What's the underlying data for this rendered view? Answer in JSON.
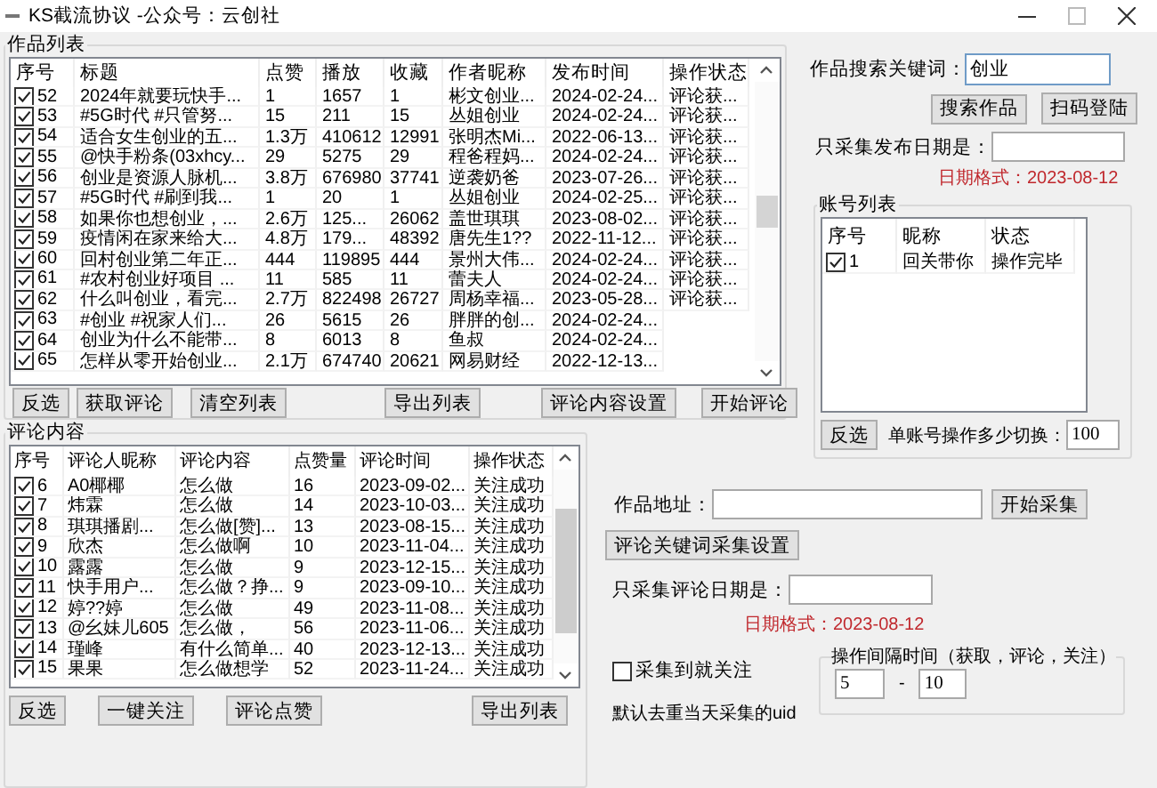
{
  "window": {
    "title": "KS截流协议 -公众号：云创社"
  },
  "works": {
    "title": "作品列表",
    "columns": [
      "序号",
      "标题",
      "点赞",
      "播放",
      "收藏",
      "作者昵称",
      "发布时间",
      "操作状态"
    ],
    "rows": [
      {
        "checked": true,
        "cells": [
          "52",
          "2024年就要玩快手...",
          "1",
          "1657",
          "1",
          "彬文创业...",
          "2024-02-24...",
          "评论获..."
        ]
      },
      {
        "checked": true,
        "cells": [
          "53",
          "#5G时代 #只管努...",
          "15",
          "211",
          "15",
          "丛姐创业",
          "2024-02-24...",
          "评论获..."
        ]
      },
      {
        "checked": true,
        "cells": [
          "54",
          "适合女生创业的五...",
          "1.3万",
          "410612",
          "12991",
          "张明杰Mi...",
          "2022-06-13...",
          "评论获..."
        ]
      },
      {
        "checked": true,
        "cells": [
          "55",
          "@快手粉条(03xhcy...",
          "29",
          "5275",
          "29",
          "程爸程妈...",
          "2024-02-24...",
          "评论获..."
        ]
      },
      {
        "checked": true,
        "cells": [
          "56",
          "创业是资源人脉机...",
          "3.8万",
          "676980",
          "37741",
          "逆袭奶爸",
          "2023-07-26...",
          "评论获..."
        ]
      },
      {
        "checked": true,
        "cells": [
          "57",
          "#5G时代 #刷到我...",
          "1",
          "20",
          "1",
          "丛姐创业",
          "2024-02-25...",
          "评论获..."
        ]
      },
      {
        "checked": true,
        "cells": [
          "58",
          "如果你也想创业，...",
          "2.6万",
          "125...",
          "26062",
          "盖世琪琪",
          "2023-08-02...",
          "评论获..."
        ]
      },
      {
        "checked": true,
        "cells": [
          "59",
          "疫情闲在家来给大...",
          "4.8万",
          "179...",
          "48392",
          "唐先生1??",
          "2022-11-12...",
          "评论获..."
        ]
      },
      {
        "checked": true,
        "cells": [
          "60",
          "回村创业第二年正...",
          "444",
          "119895",
          "444",
          "景州大伟...",
          "2024-02-24...",
          "评论获..."
        ]
      },
      {
        "checked": true,
        "cells": [
          "61",
          "#农村创业好项目 ...",
          "11",
          "585",
          "11",
          "蕾夫人",
          "2024-02-24...",
          "评论获..."
        ]
      },
      {
        "checked": true,
        "cells": [
          "62",
          "什么叫创业，看完...",
          "2.7万",
          "822498",
          "26727",
          "周杨幸福...",
          "2023-05-28...",
          "评论获..."
        ]
      },
      {
        "checked": true,
        "cells": [
          "63",
          "#创业 #祝家人们...",
          "26",
          "5615",
          "26",
          "胖胖的创...",
          "2024-02-24..."
        ]
      },
      {
        "checked": true,
        "cells": [
          "64",
          "创业为什么不能带...",
          "8",
          "6013",
          "8",
          "鱼叔",
          "2024-02-24..."
        ]
      },
      {
        "checked": true,
        "cells": [
          "65",
          "怎样从零开始创业...",
          "2.1万",
          "674740",
          "20621",
          "网易财经",
          "2022-12-13..."
        ]
      }
    ],
    "buttons": [
      "反选",
      "获取评论",
      "清空列表",
      "导出列表",
      "评论内容设置",
      "开始评论"
    ]
  },
  "comments": {
    "title": "评论内容",
    "columns": [
      "序号",
      "评论人昵称",
      "评论内容",
      "点赞量",
      "评论时间",
      "操作状态"
    ],
    "rows": [
      {
        "checked": true,
        "cells": [
          "6",
          "A0椰椰",
          "怎么做",
          "16",
          "2023-09-02...",
          "关注成功"
        ]
      },
      {
        "checked": true,
        "cells": [
          "7",
          "炜霖",
          "怎么做",
          "14",
          "2023-10-03...",
          "关注成功"
        ]
      },
      {
        "checked": true,
        "cells": [
          "8",
          "琪琪播剧...",
          "怎么做[赞]...",
          "13",
          "2023-08-15...",
          "关注成功"
        ]
      },
      {
        "checked": true,
        "cells": [
          "9",
          "欣杰",
          "怎么做啊",
          "10",
          "2023-11-04...",
          "关注成功"
        ]
      },
      {
        "checked": true,
        "cells": [
          "10",
          "露露",
          "怎么做",
          "9",
          "2023-12-15...",
          "关注成功"
        ]
      },
      {
        "checked": true,
        "cells": [
          "11",
          "快手用户...",
          "怎么做？挣...",
          "9",
          "2023-09-10...",
          "关注成功"
        ]
      },
      {
        "checked": true,
        "cells": [
          "12",
          "婷??婷",
          "怎么做",
          "49",
          "2023-11-08...",
          "关注成功"
        ]
      },
      {
        "checked": true,
        "cells": [
          "13",
          "@幺妹儿605",
          "怎么做，",
          "56",
          "2023-11-06...",
          "关注成功"
        ]
      },
      {
        "checked": true,
        "cells": [
          "14",
          "瑾峰",
          "有什么简单...",
          "40",
          "2023-12-13...",
          "关注成功"
        ]
      },
      {
        "checked": true,
        "cells": [
          "15",
          "果果",
          "怎么做想学",
          "52",
          "2023-11-24...",
          "关注成功"
        ]
      }
    ],
    "buttons": [
      "反选",
      "一键关注",
      "评论点赞",
      "导出列表"
    ]
  },
  "search": {
    "label": "作品搜索关键词：",
    "value": "创业",
    "buttons": [
      "搜索作品",
      "扫码登陆"
    ]
  },
  "publish_date": {
    "label": "只采集发布日期是：",
    "hint": "日期格式：2023-08-12"
  },
  "accounts": {
    "title": "账号列表",
    "columns": [
      "序号",
      "昵称",
      "状态"
    ],
    "rows": [
      {
        "checked": true,
        "cells": [
          "1",
          "回关带你",
          "操作完毕"
        ]
      }
    ],
    "invert_button": "反选",
    "switch_label": "单账号操作多少切换：",
    "switch_value": "100"
  },
  "collect": {
    "address_label": "作品地址：",
    "start_button": "开始采集",
    "keyword_button": "评论关键词采集设置",
    "date_label": "只采集评论日期是：",
    "date_hint": "日期格式：2023-08-12",
    "follow": {
      "label": "采集到就关注",
      "checked": false
    },
    "dedupe_note": "默认去重当天采集的uid",
    "interval": {
      "title": "操作间隔时间（获取，评论，关注）",
      "min": "5",
      "separator": "-",
      "max": "10"
    }
  }
}
